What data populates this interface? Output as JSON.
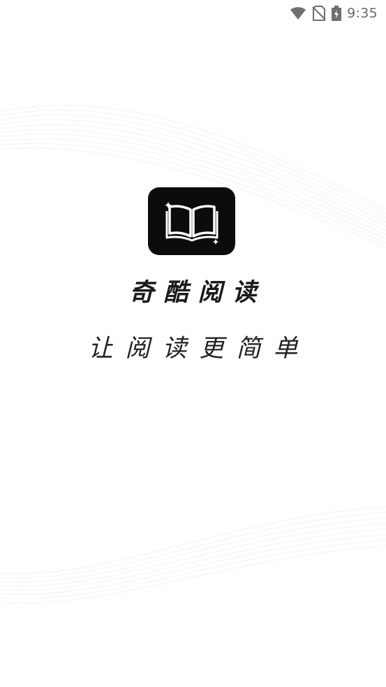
{
  "status_bar": {
    "time": "9:35",
    "icons": [
      "wifi-icon",
      "no-sim-icon",
      "battery-charging-icon"
    ]
  },
  "splash": {
    "logo_icon": "open-book-icon",
    "app_name": "奇酷阅读",
    "slogan": "让阅读更简单"
  },
  "colors": {
    "background": "#ffffff",
    "logo_background": "#0c0c0c",
    "text": "#1b1b1b"
  }
}
